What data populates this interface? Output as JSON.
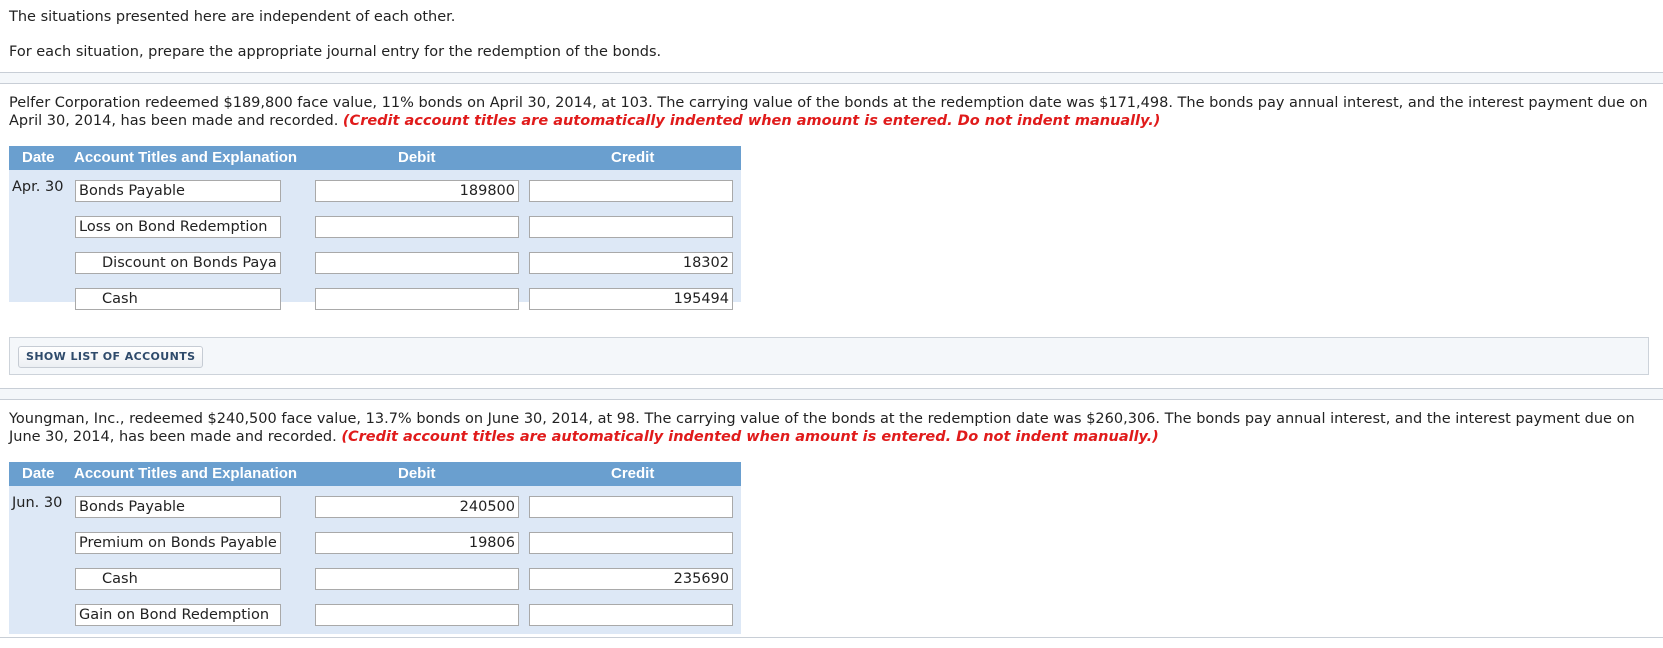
{
  "intro": {
    "line1": "The situations presented here are independent of each other.",
    "line2": "For each situation, prepare the appropriate journal entry for the redemption of the bonds."
  },
  "situations": [
    {
      "problem_text": "Pelfer Corporation redeemed $189,800 face value, 11% bonds on April 30, 2014, at 103. The carrying value of the bonds at the redemption date was $171,498. The bonds pay annual interest, and the interest payment due on April 30, 2014, has been made and recorded.",
      "note": "(Credit account titles are automatically indented when amount is entered. Do not indent manually.)",
      "table": {
        "headers": {
          "date": "Date",
          "account": "Account Titles and Explanation",
          "debit": "Debit",
          "credit": "Credit"
        },
        "rows": [
          {
            "date": "Apr. 30",
            "account": "Bonds Payable",
            "debit": "189800",
            "credit": "",
            "indent": false
          },
          {
            "date": "",
            "account": "Loss on Bond Redemption",
            "debit": "",
            "credit": "",
            "indent": false
          },
          {
            "date": "",
            "account": "Discount on Bonds Paya",
            "debit": "",
            "credit": "18302",
            "indent": true
          },
          {
            "date": "",
            "account": "Cash",
            "debit": "",
            "credit": "195494",
            "indent": true
          }
        ]
      }
    },
    {
      "problem_text": "Youngman, Inc., redeemed $240,500 face value, 13.7% bonds on June 30, 2014, at 98. The carrying value of the bonds at the redemption date was $260,306. The bonds pay annual interest, and the interest payment due on June 30, 2014, has been made and recorded.",
      "note": "(Credit account titles are automatically indented when amount is entered. Do not indent manually.)",
      "table": {
        "headers": {
          "date": "Date",
          "account": "Account Titles and Explanation",
          "debit": "Debit",
          "credit": "Credit"
        },
        "rows": [
          {
            "date": "Jun. 30",
            "account": "Bonds Payable",
            "debit": "240500",
            "credit": "",
            "indent": false
          },
          {
            "date": "",
            "account": "Premium on Bonds Payable",
            "debit": "19806",
            "credit": "",
            "indent": false
          },
          {
            "date": "",
            "account": "Cash",
            "debit": "",
            "credit": "235690",
            "indent": true
          },
          {
            "date": "",
            "account": "Gain on Bond Redemption",
            "debit": "",
            "credit": "",
            "indent": false
          }
        ]
      }
    }
  ],
  "show_accounts_button": "SHOW LIST OF ACCOUNTS",
  "colors": {
    "header_bg": "#6a9fcf",
    "table_bg": "#dde8f6",
    "note_red": "#e01b1b"
  }
}
